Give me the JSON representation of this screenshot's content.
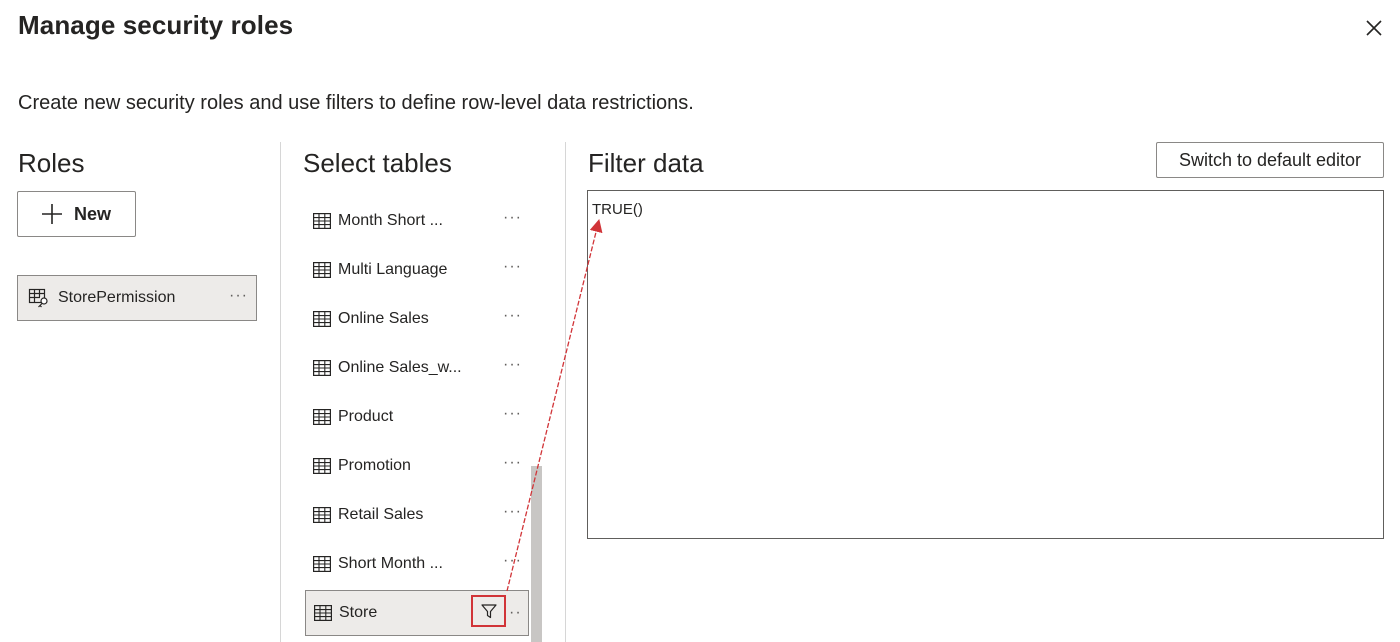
{
  "dialog": {
    "title": "Manage security roles",
    "description": "Create new security roles and use filters to define row-level data restrictions."
  },
  "roles": {
    "heading": "Roles",
    "new_label": "New",
    "items": [
      {
        "label": "StorePermission",
        "more": "···"
      }
    ]
  },
  "tables": {
    "heading": "Select tables",
    "items": [
      {
        "label": "Month Short ...",
        "more": "···"
      },
      {
        "label": "Multi Language",
        "more": "···"
      },
      {
        "label": "Online Sales",
        "more": "···"
      },
      {
        "label": "Online Sales_w...",
        "more": "···"
      },
      {
        "label": "Product",
        "more": "···"
      },
      {
        "label": "Promotion",
        "more": "···"
      },
      {
        "label": "Retail Sales",
        "more": "···"
      },
      {
        "label": "Short Month ...",
        "more": "···"
      },
      {
        "label": "Store",
        "more": "··",
        "selected": true
      }
    ]
  },
  "filter": {
    "heading": "Filter data",
    "switch_label": "Switch to default editor",
    "expression": "TRUE()"
  },
  "colors": {
    "accent_red": "#d13438",
    "selected_bg": "#edebe9",
    "border": "#8a8886"
  },
  "icons": [
    "close-icon",
    "plus-icon",
    "role-icon",
    "table-icon",
    "filter-icon"
  ]
}
